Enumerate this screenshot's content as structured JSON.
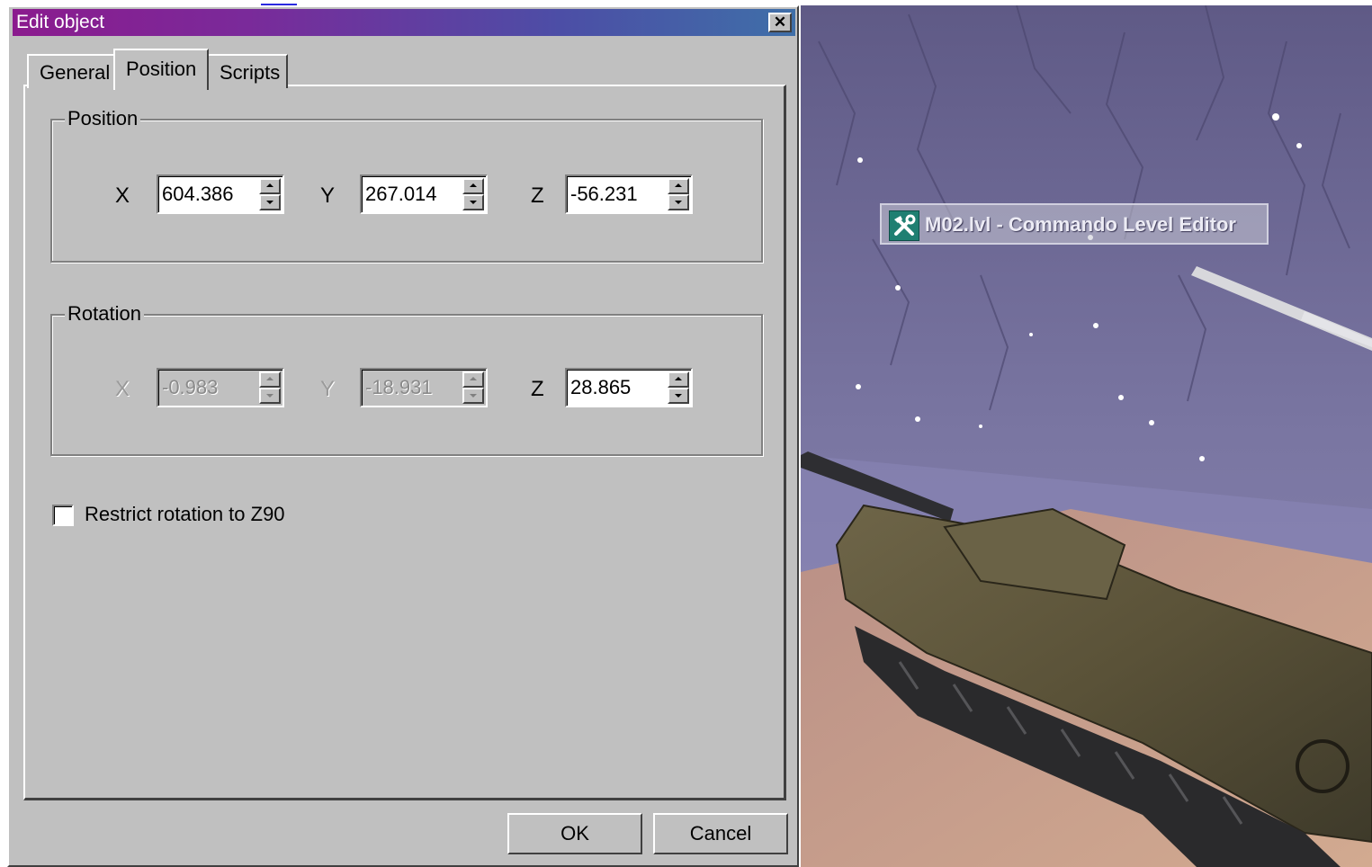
{
  "dialog": {
    "title": "Edit object",
    "close_symbol": "✕",
    "tabs": [
      {
        "label": "General"
      },
      {
        "label": "Position"
      },
      {
        "label": "Scripts"
      }
    ],
    "active_tab": "Position",
    "position_group": {
      "label": "Position",
      "x_label": "X",
      "x_value": "604.386",
      "y_label": "Y",
      "y_value": "267.014",
      "z_label": "Z",
      "z_value": "-56.231"
    },
    "rotation_group": {
      "label": "Rotation",
      "x_label": "X",
      "x_value": "-0.983",
      "y_label": "Y",
      "y_value": "-18.931",
      "z_label": "Z",
      "z_value": "28.865"
    },
    "restrict_rotation": {
      "label": "Restrict rotation to Z90",
      "checked": false
    },
    "ok_label": "OK",
    "cancel_label": "Cancel"
  },
  "viewport": {
    "tooltip_text": "M02.lvl - Commando Level Editor",
    "tooltip_icon": "tools-icon"
  },
  "colors": {
    "dialog_face": "#c0c0c0",
    "title_gradient_start": "#8b1b8e",
    "title_gradient_end": "#3f6fa8",
    "sky": "#6f6a94",
    "ground": "#c9a08c"
  }
}
